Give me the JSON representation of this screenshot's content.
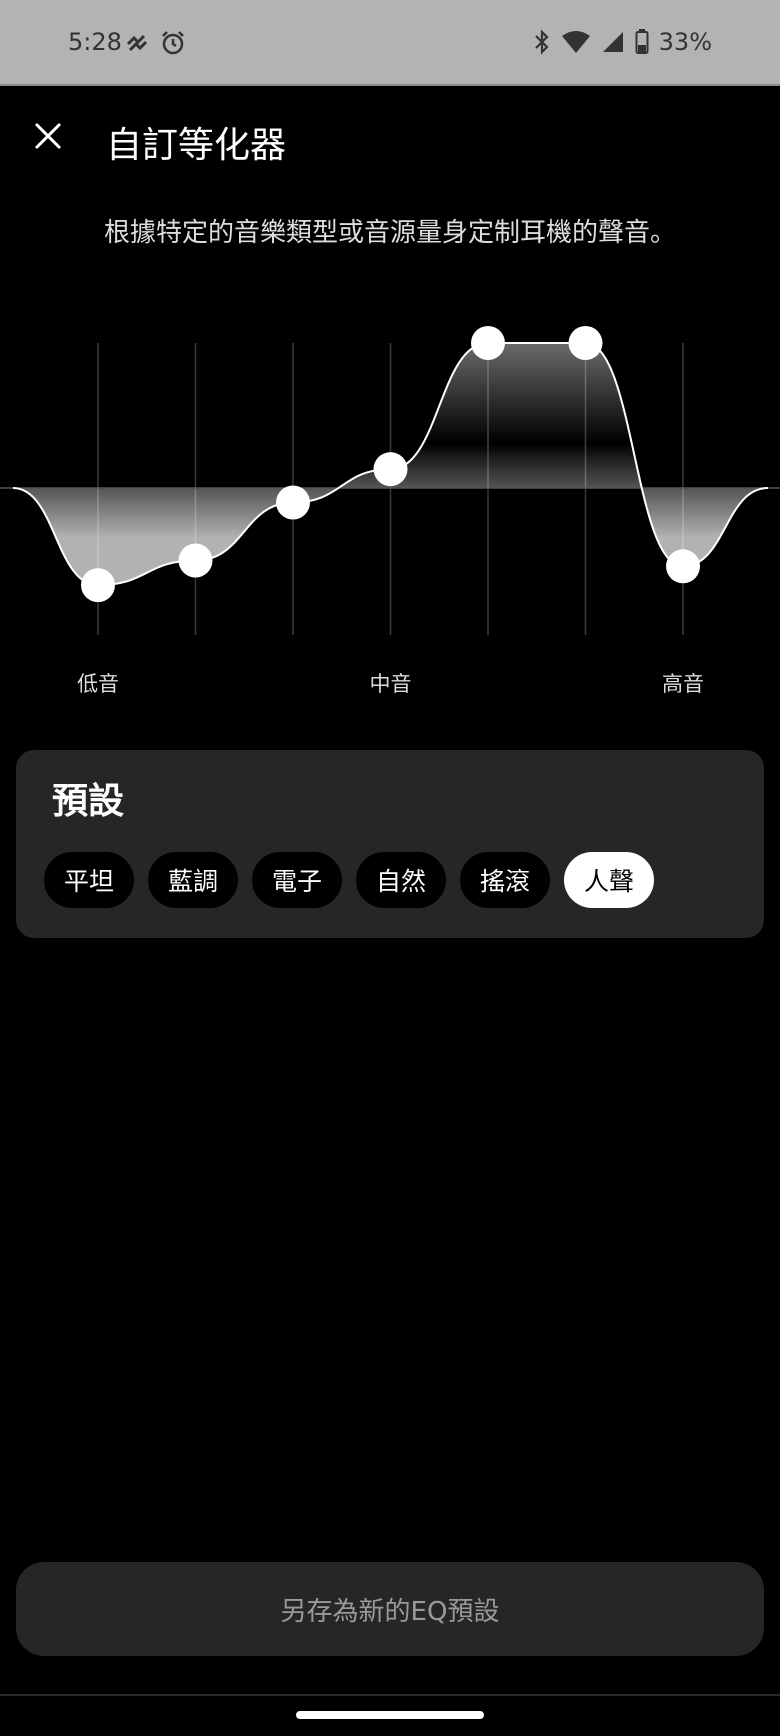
{
  "status_bar": {
    "time": "5:28",
    "battery": "33%",
    "icons": [
      "notification-icon",
      "alarm-icon",
      "bluetooth-icon",
      "wifi-icon",
      "signal-icon",
      "battery-icon"
    ]
  },
  "header": {
    "title": "自訂等化器",
    "close_icon": "close-icon"
  },
  "description": "根據特定的音樂類型或音源量身定制耳機的聲音。",
  "equalizer": {
    "band_labels": {
      "low": "低音",
      "mid": "中音",
      "high": "高音"
    },
    "range": [
      -1,
      1
    ],
    "levels": [
      -0.67,
      -0.5,
      -0.1,
      0.13,
      1.0,
      1.0,
      -0.54
    ]
  },
  "presets": {
    "title": "預設",
    "items": [
      {
        "label": "平坦",
        "selected": false
      },
      {
        "label": "藍調",
        "selected": false
      },
      {
        "label": "電子",
        "selected": false
      },
      {
        "label": "自然",
        "selected": false
      },
      {
        "label": "搖滾",
        "selected": false
      },
      {
        "label": "人聲",
        "selected": true
      }
    ]
  },
  "save_button": {
    "label": "另存為新的EQ預設"
  },
  "colors": {
    "background": "#000000",
    "card": "#262626",
    "status_bar": "#b3b3b3",
    "accent": "#ffffff"
  }
}
